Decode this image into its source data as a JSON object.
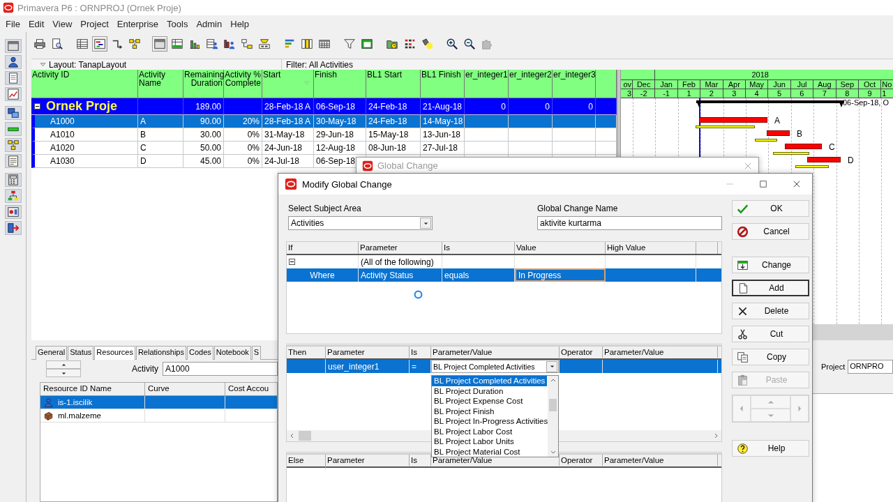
{
  "window": {
    "title": "Primavera P6 : ORNPROJ (Ornek Proje)"
  },
  "menu": [
    "File",
    "Edit",
    "View",
    "Project",
    "Enterprise",
    "Tools",
    "Admin",
    "Help"
  ],
  "toolbar": [
    [
      {
        "pressed": false
      },
      {
        "pressed": false
      }
    ],
    [
      {
        "pressed": false
      },
      {
        "pressed": true
      },
      {
        "pressed": false
      },
      {
        "pressed": false
      }
    ],
    [
      {
        "pressed": true
      },
      {
        "pressed": false
      },
      {
        "pressed": false
      },
      {
        "pressed": false
      },
      {
        "pressed": false
      },
      {
        "pressed": false
      },
      {
        "pressed": false
      }
    ],
    [
      {
        "pressed": false
      },
      {
        "pressed": false
      },
      {
        "pressed": false
      }
    ],
    [
      {
        "pressed": false
      },
      {
        "pressed": false
      }
    ],
    [
      {
        "pressed": false
      },
      {
        "pressed": false
      },
      {
        "pressed": false
      }
    ],
    [
      {
        "pressed": false
      },
      {
        "pressed": false
      },
      {
        "pressed": false
      }
    ]
  ],
  "layout_bar": {
    "layout": "Layout: TanapLayout",
    "filter": "Filter: All Activities"
  },
  "activity_table": {
    "columns": [
      {
        "label": "Activity ID",
        "sorted": false
      },
      {
        "label": "Activity Name",
        "sorted": false
      },
      {
        "label": "Remaining Duration",
        "sorted": false
      },
      {
        "label": "Activity % Complete",
        "sorted": false
      },
      {
        "label": "Start",
        "sorted": true
      },
      {
        "label": "Finish",
        "sorted": false
      },
      {
        "label": "BL1 Start",
        "sorted": false
      },
      {
        "label": "BL1 Finish",
        "sorted": false
      },
      {
        "label": "er_integer1",
        "sorted": false
      },
      {
        "label": "er_integer2",
        "sorted": false
      },
      {
        "label": "er_integer3",
        "sorted": false
      }
    ],
    "summary": {
      "name": "Ornek Proje",
      "expanded": true,
      "remaining_duration": "189.00",
      "start": "28-Feb-18 A",
      "finish": "06-Sep-18",
      "bl1_start": "24-Feb-18",
      "bl1_finish": "21-Aug-18",
      "integers": [
        "0",
        "0",
        "0"
      ]
    },
    "rows": [
      {
        "id": "A1000",
        "name": "A",
        "remaining_duration": "90.00",
        "percent_complete": "20%",
        "start": "28-Feb-18 A",
        "finish": "30-May-18",
        "bl1_start": "24-Feb-18",
        "bl1_finish": "14-May-18",
        "selected": true
      },
      {
        "id": "A1010",
        "name": "B",
        "remaining_duration": "30.00",
        "percent_complete": "0%",
        "start": "31-May-18",
        "finish": "29-Jun-18",
        "bl1_start": "15-May-18",
        "bl1_finish": "13-Jun-18",
        "selected": false
      },
      {
        "id": "A1020",
        "name": "C",
        "remaining_duration": "50.00",
        "percent_complete": "0%",
        "start": "24-Jun-18",
        "finish": "12-Aug-18",
        "bl1_start": "08-Jun-18",
        "bl1_finish": "27-Jul-18",
        "selected": false
      },
      {
        "id": "A1030",
        "name": "D",
        "remaining_duration": "45.00",
        "percent_complete": "0%",
        "start": "24-Jul-18",
        "finish": "06-Sep-18",
        "selected": false
      }
    ]
  },
  "gantt": {
    "year": "2018",
    "months": [
      "ov",
      "Dec",
      "Jan",
      "Feb",
      "Mar",
      "Apr",
      "May",
      "Jun",
      "Jul",
      "Aug",
      "Sep",
      "Oct",
      "No"
    ],
    "periods": [
      "3",
      "-2",
      "-1",
      "1",
      "2",
      "3",
      "4",
      "5",
      "6",
      "7",
      "8",
      "9",
      "1"
    ],
    "summary_label": "06-Sep-18, O",
    "bar_labels": [
      "A",
      "B",
      "C",
      "D"
    ]
  },
  "details": {
    "tabs": [
      {
        "label": "General",
        "selected": false
      },
      {
        "label": "Status",
        "selected": false
      },
      {
        "label": "Resources",
        "selected": true
      },
      {
        "label": "Relationships",
        "selected": false
      },
      {
        "label": "Codes",
        "selected": false
      },
      {
        "label": "Notebook",
        "selected": false
      },
      {
        "label": "S",
        "selected": false
      }
    ],
    "activity_label": "Activity",
    "activity_value": "A1000",
    "columns": [
      "Resource ID Name",
      "Curve",
      "Cost Accou"
    ],
    "resources": [
      {
        "name": "is-1.iscilik",
        "kind": "labor",
        "selected": true
      },
      {
        "name": "ml.malzeme",
        "kind": "material",
        "selected": false
      }
    ],
    "project_label": "Project",
    "project_value": "ORNPRO"
  },
  "global_change": {
    "title": "Global Change"
  },
  "modify_dialog": {
    "title": "Modify Global Change",
    "subject_area_label": "Select Subject Area",
    "subject_area": "Activities",
    "name_label": "Global Change Name",
    "name": "aktivite kurtarma",
    "if_grid": {
      "columns": [
        "If",
        "Parameter",
        "Is",
        "Value",
        "High Value"
      ],
      "group": {
        "label": "(All of the following)",
        "expanded": true
      },
      "rows": [
        {
          "where": "Where",
          "parameter": "Activity Status",
          "is": "equals",
          "value": "In Progress",
          "selected": true
        }
      ]
    },
    "then_grid": {
      "columns": [
        "Then",
        "Parameter",
        "Is",
        "Parameter/Value",
        "Operator",
        "Parameter/Value"
      ],
      "rows": [
        {
          "parameter": "user_integer1",
          "is": "=",
          "value": "BL Project Completed Activities",
          "selected": true
        }
      ]
    },
    "dropdown": [
      {
        "label": "BL Project Completed Activities",
        "selected": true
      },
      {
        "label": "BL Project Duration",
        "selected": false
      },
      {
        "label": "BL Project Expense Cost",
        "selected": false
      },
      {
        "label": "BL Project Finish",
        "selected": false
      },
      {
        "label": "BL Project In-Progress Activities",
        "selected": false
      },
      {
        "label": "BL Project Labor Cost",
        "selected": false
      },
      {
        "label": "BL Project Labor Units",
        "selected": false
      },
      {
        "label": "BL Project Material Cost",
        "selected": false
      }
    ],
    "else_grid": {
      "columns": [
        "Else",
        "Parameter",
        "Is",
        "Parameter/Value",
        "Operator",
        "Parameter/Value"
      ]
    },
    "buttons": [
      {
        "label": "OK",
        "kind": "ok",
        "disabled": false,
        "focused": false
      },
      {
        "label": "Cancel",
        "kind": "cancel",
        "disabled": false,
        "focused": false
      },
      {
        "label": "Change",
        "kind": "change",
        "disabled": false,
        "focused": false
      },
      {
        "label": "Add",
        "kind": "add",
        "disabled": false,
        "focused": true
      },
      {
        "label": "Delete",
        "kind": "delete",
        "disabled": false,
        "focused": false
      },
      {
        "label": "Cut",
        "kind": "cut",
        "disabled": false,
        "focused": false
      },
      {
        "label": "Copy",
        "kind": "copy",
        "disabled": false,
        "focused": false
      },
      {
        "label": "Paste",
        "kind": "paste",
        "disabled": true,
        "focused": false
      },
      {
        "label": "Help",
        "kind": "help",
        "disabled": false,
        "focused": false
      }
    ],
    "move_pad": {
      "disabled": true
    }
  }
}
